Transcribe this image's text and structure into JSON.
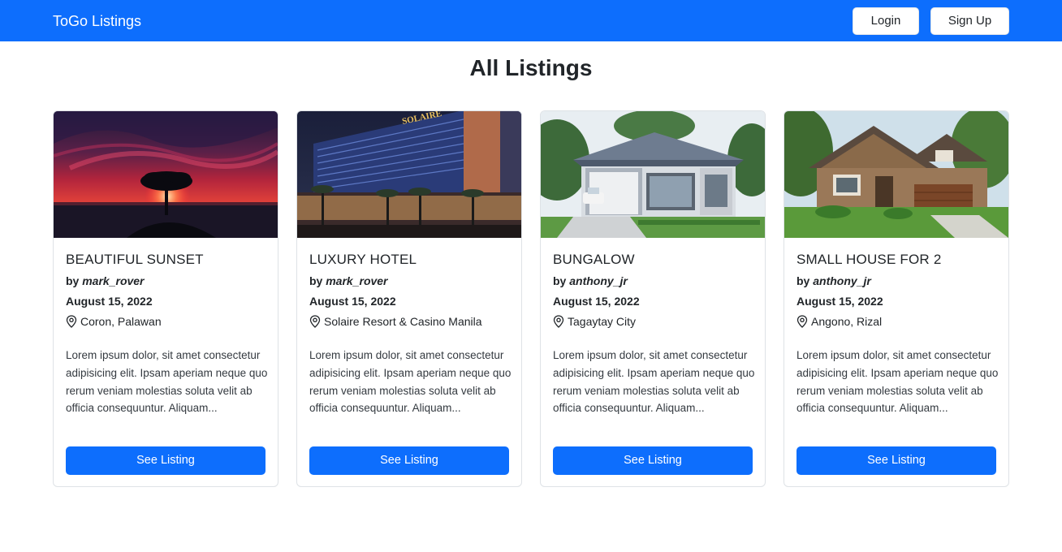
{
  "navbar": {
    "brand": "ToGo Listings",
    "login_label": "Login",
    "signup_label": "Sign Up",
    "accent_color": "#0d6efd"
  },
  "page": {
    "title": "All Listings"
  },
  "listings": [
    {
      "title": "BEAUTIFUL SUNSET",
      "by_label": "by",
      "author": "mark_rover",
      "date": "August 15, 2022",
      "location": "Coron, Palawan",
      "description": "Lorem ipsum dolor, sit amet consectetur adipisicing elit. Ipsam aperiam neque quo rerum veniam molestias soluta velit ab officia consequuntur. Aliquam...",
      "button_label": "See Listing",
      "image": "sunset-tree-photo"
    },
    {
      "title": "LUXURY HOTEL",
      "by_label": "by",
      "author": "mark_rover",
      "date": "August 15, 2022",
      "location": "Solaire Resort & Casino Manila",
      "description": "Lorem ipsum dolor, sit amet consectetur adipisicing elit. Ipsam aperiam neque quo rerum veniam molestias soluta velit ab officia consequuntur. Aliquam...",
      "button_label": "See Listing",
      "image": "hotel-night-photo"
    },
    {
      "title": "BUNGALOW",
      "by_label": "by",
      "author": "anthony_jr",
      "date": "August 15, 2022",
      "location": "Tagaytay City",
      "description": "Lorem ipsum dolor, sit amet consectetur adipisicing elit. Ipsam aperiam neque quo rerum veniam molestias soluta velit ab officia consequuntur. Aliquam...",
      "button_label": "See Listing",
      "image": "bungalow-house-photo"
    },
    {
      "title": "SMALL HOUSE FOR 2",
      "by_label": "by",
      "author": "anthony_jr",
      "date": "August 15, 2022",
      "location": "Angono, Rizal",
      "description": "Lorem ipsum dolor, sit amet consectetur adipisicing elit. Ipsam aperiam neque quo rerum veniam molestias soluta velit ab officia consequuntur. Aliquam...",
      "button_label": "See Listing",
      "image": "craftsman-house-photo"
    }
  ]
}
